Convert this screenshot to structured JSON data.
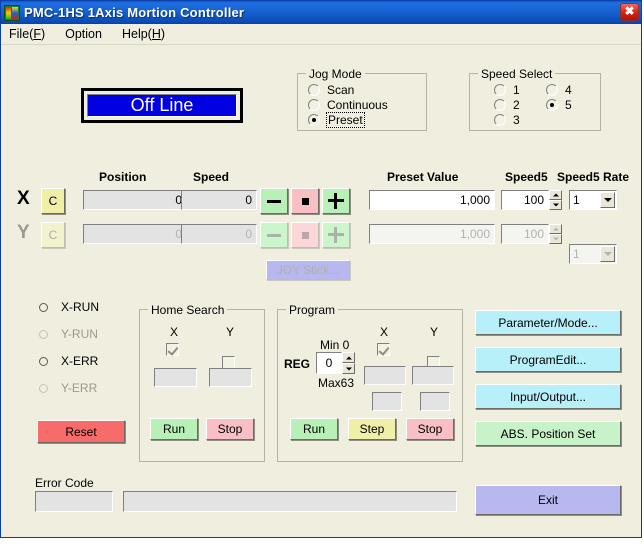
{
  "window": {
    "title": "PMC-1HS 1Axis Mortion Controller",
    "close_label": "✖",
    "icon": "app-icon"
  },
  "menu": [
    {
      "pre": "File(",
      "mnemonic": "F",
      "post": ")"
    },
    {
      "pre": "Option",
      "mnemonic": "",
      "post": ""
    },
    {
      "pre": "Help(",
      "mnemonic": "H",
      "post": ")"
    }
  ],
  "status": {
    "online_label": "Off Line"
  },
  "jog_mode": {
    "title": "Jog Mode",
    "options": [
      {
        "label": "Scan",
        "selected": false
      },
      {
        "label": "Continuous",
        "selected": false
      },
      {
        "label": "Preset",
        "selected": true
      }
    ]
  },
  "speed_select": {
    "title": "Speed Select",
    "options": [
      {
        "label": "1",
        "selected": false
      },
      {
        "label": "2",
        "selected": false
      },
      {
        "label": "3",
        "selected": false
      },
      {
        "label": "4",
        "selected": false
      },
      {
        "label": "5",
        "selected": true
      }
    ]
  },
  "axis_headers": {
    "position": "Position",
    "speed": "Speed",
    "preset_value": "Preset Value",
    "speed5": "Speed5",
    "speed5_rate": "Speed5 Rate"
  },
  "axes": [
    {
      "name": "X",
      "enabled": true,
      "clear_label": "C",
      "position": "0",
      "speed": "0",
      "preset_value": "1,000",
      "speed5": "100",
      "speed5_rate": "1"
    },
    {
      "name": "Y",
      "enabled": false,
      "clear_label": "C",
      "position": "0",
      "speed": "0",
      "preset_value": "1,000",
      "speed5": "100",
      "speed5_rate": "1"
    }
  ],
  "joystick": {
    "label": "JOY Stick..."
  },
  "indicators": [
    {
      "label": "X-RUN",
      "enabled": true
    },
    {
      "label": "Y-RUN",
      "enabled": false
    },
    {
      "label": "X-ERR",
      "enabled": true
    },
    {
      "label": "Y-ERR",
      "enabled": false
    }
  ],
  "reset": {
    "label": "Reset"
  },
  "home_search": {
    "title": "Home Search",
    "col_x": "X",
    "col_y": "Y",
    "check_x": true,
    "check_y": false,
    "value_x": "",
    "value_y": "",
    "run_label": "Run",
    "stop_label": "Stop"
  },
  "program": {
    "title": "Program",
    "reg_label": "REG",
    "reg_value": "0",
    "min_label": "Min 0",
    "max_label": "Max63",
    "col_x": "X",
    "col_y": "Y",
    "check_x": true,
    "check_y": false,
    "value_x1": "",
    "value_y1": "",
    "value_x2": "",
    "value_y2": "",
    "run_label": "Run",
    "step_label": "Step",
    "stop_label": "Stop"
  },
  "side_buttons": [
    {
      "label": "Parameter/Mode...",
      "color": "cyan"
    },
    {
      "label": "ProgramEdit...",
      "color": "cyan"
    },
    {
      "label": "Input/Output...",
      "color": "cyan"
    },
    {
      "label": "ABS. Position Set",
      "color": "green"
    }
  ],
  "error": {
    "label": "Error Code",
    "code": "",
    "message": ""
  },
  "exit": {
    "label": "Exit"
  },
  "colors": {
    "title_bar": "#1560cf",
    "face": "#f0efdf",
    "offline_bg": "#0000e0",
    "reset": "#f86b6b",
    "run": "#b8f0b8",
    "stop": "#f8c0c4",
    "step": "#f0efa8",
    "side": "#b8f0fa",
    "abs": "#c8f2c8",
    "exit": "#b8b8f0"
  }
}
